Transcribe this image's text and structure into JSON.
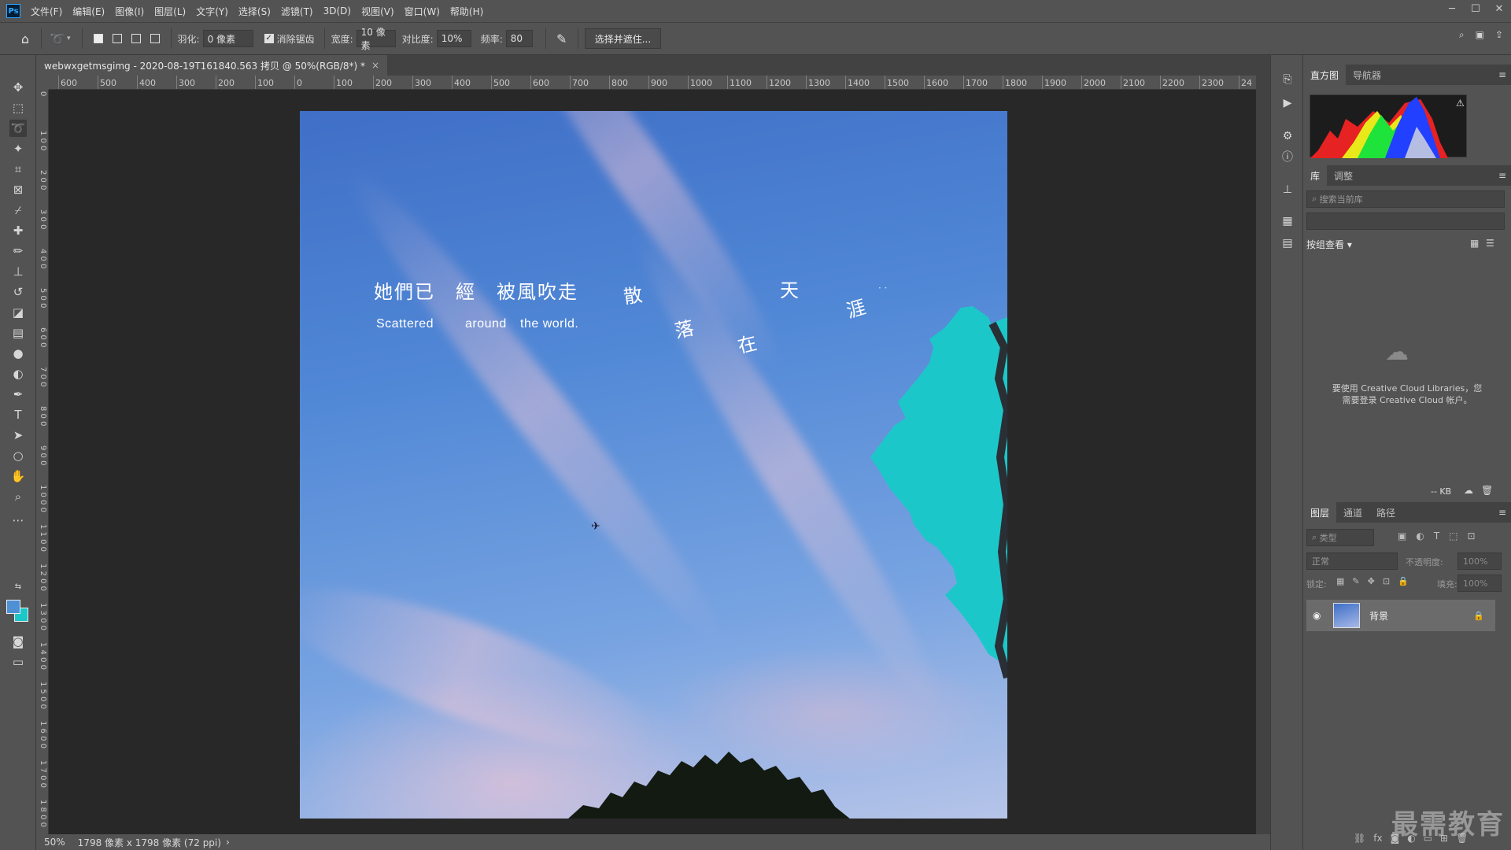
{
  "app": {
    "logo": "Ps"
  },
  "menu": [
    "文件(F)",
    "编辑(E)",
    "图像(I)",
    "图层(L)",
    "文字(Y)",
    "选择(S)",
    "滤镜(T)",
    "3D(D)",
    "视图(V)",
    "窗口(W)",
    "帮助(H)"
  ],
  "window_controls": {
    "minimize": "─",
    "maximize": "☐",
    "close": "✕"
  },
  "options": {
    "feather_label": "羽化:",
    "feather_value": "0 像素",
    "antialias_label": "消除锯齿",
    "antialias_checked": true,
    "width_label": "宽度:",
    "width_value": "10 像素",
    "contrast_label": "对比度:",
    "contrast_value": "10%",
    "frequency_label": "频率:",
    "frequency_value": "80",
    "select_mask_label": "选择并遮住..."
  },
  "document": {
    "tab_title": "webwxgetmsgimg - 2020-08-19T161840.563 拷贝 @ 50%(RGB/8*) *",
    "tab_close": "×"
  },
  "ruler": {
    "top": [
      "600",
      "500",
      "400",
      "300",
      "200",
      "100",
      "0",
      "100",
      "200",
      "300",
      "400",
      "500",
      "600",
      "700",
      "800",
      "900",
      "1000",
      "1100",
      "1200",
      "1300",
      "1400",
      "1500",
      "1600",
      "1700",
      "1800",
      "1900",
      "2000",
      "2100",
      "2200",
      "2300",
      "24"
    ],
    "left": [
      "0",
      "1 0 0",
      "2 0 0",
      "3 0 0",
      "4 0 0",
      "5 0 0",
      "6 0 0",
      "7 0 0",
      "8 0 0",
      "9 0 0",
      "1 0 0 0",
      "1 1 0 0",
      "1 2 0 0",
      "1 3 0 0",
      "1 4 0 0",
      "1 5 0 0",
      "1 6 0 0",
      "1 7 0 0",
      "1 8 0 0"
    ]
  },
  "image_text": {
    "cn_line1": "她們已　經　被風吹走",
    "san": "散",
    "luo": "落",
    "zai": "在",
    "tian": "天",
    "ya": "涯",
    "dots": "· ·",
    "en_scattered": "Scattered",
    "en_around": "around",
    "en_world": "the world."
  },
  "status": {
    "zoom": "50%",
    "info": "1798 像素 x 1798 像素 (72 ppi)",
    "arrow": "›"
  },
  "panels": {
    "top_tabs": [
      "直方图",
      "导航器"
    ],
    "lib_tabs": [
      "库",
      "调整"
    ],
    "lib_search_placeholder": "搜索当前库",
    "lib_view": "按组查看",
    "cc_message_1": "要使用 Creative Cloud Libraries，您",
    "cc_message_2": "需要登录 Creative Cloud 帐户。",
    "kb_label": "-- KB",
    "layer_tabs": [
      "图层",
      "通道",
      "路径"
    ],
    "layer_filter": "类型",
    "blend_mode": "正常",
    "opacity_label": "不透明度:",
    "opacity_value": "100%",
    "lock_label": "锁定:",
    "fill_label": "填充:",
    "fill_value": "100%",
    "layer_name": "背景"
  },
  "watermark": "最需教育",
  "colors": {
    "foreground": "#4d90d4",
    "background": "#1cc7c9",
    "teal_shape": "#1cc7c9"
  }
}
